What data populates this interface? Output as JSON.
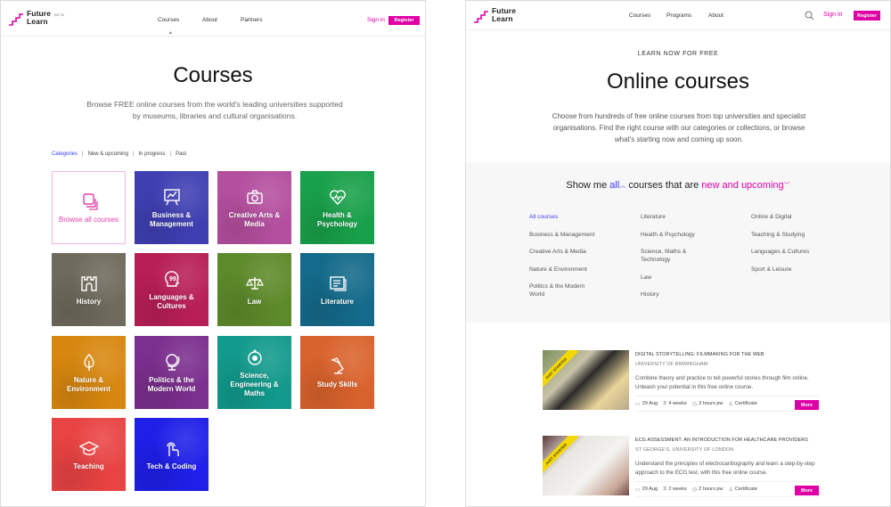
{
  "left": {
    "header": {
      "logo_line1": "Future",
      "logo_line2": "Learn",
      "beta": "BETA",
      "nav": [
        "Courses",
        "About",
        "Partners"
      ],
      "sign_in": "Sign in",
      "register": "Register"
    },
    "title": "Courses",
    "subtitle": "Browse FREE online courses from the world's leading universities supported by museums, libraries and cultural organisations.",
    "tabs": [
      "Categories",
      "New & upcoming",
      "In progress",
      "Past"
    ],
    "active_tab": "Categories",
    "tiles": [
      {
        "label": "Browse all courses",
        "icon": "stack-icon",
        "color": "#ffffff"
      },
      {
        "label": "Business & Management",
        "icon": "presentation-chart-icon",
        "color": "#3f3fb2"
      },
      {
        "label": "Creative Arts & Media",
        "icon": "camera-icon",
        "color": "#b44f9e"
      },
      {
        "label": "Health & Psychology",
        "icon": "heart-pulse-icon",
        "color": "#19a04a"
      },
      {
        "label": "History",
        "icon": "castle-icon",
        "color": "#6e6a5c"
      },
      {
        "label": "Languages & Cultures",
        "icon": "speech-head-icon",
        "color": "#b81f55"
      },
      {
        "label": "Law",
        "icon": "scales-icon",
        "color": "#5d8a2a"
      },
      {
        "label": "Literature",
        "icon": "book-icon",
        "color": "#146a8a"
      },
      {
        "label": "Nature & Environment",
        "icon": "leaf-icon",
        "color": "#d7870f"
      },
      {
        "label": "Politics & the Modern World",
        "icon": "globe-icon",
        "color": "#7b2f8e"
      },
      {
        "label": "Science, Engineering & Maths",
        "icon": "atom-icon",
        "color": "#129a8c"
      },
      {
        "label": "Study Skills",
        "icon": "desk-lamp-icon",
        "color": "#d9632d"
      },
      {
        "label": "Teaching",
        "icon": "graduation-cap-icon",
        "color": "#e94343"
      },
      {
        "label": "Tech & Coding",
        "icon": "touch-hand-icon",
        "color": "#1f1fe8"
      }
    ]
  },
  "right": {
    "header": {
      "logo_line1": "Future",
      "logo_line2": "Learn",
      "nav": [
        "Courses",
        "Programs",
        "About"
      ],
      "sign_in": "Sign in",
      "register": "Register"
    },
    "kicker": "LEARN NOW FOR FREE",
    "title": "Online courses",
    "subtitle": "Choose from hundreds of free online courses from top universities and specialist organisations. Find the right course with our categories or collections, or browse what's starting now and coming up soon.",
    "filter": {
      "prefix": "Show me",
      "scope": "all",
      "middle": "courses that are",
      "status": "new and upcoming",
      "columns": [
        [
          "All courses",
          "Business & Management",
          "Creative Arts & Media",
          "Nature & Environment",
          "Politics & the Modern World"
        ],
        [
          "Literature",
          "Health & Psychology",
          "Science, Maths & Technology",
          "Law",
          "History"
        ],
        [
          "Online & Digital",
          "Teaching & Studying",
          "Languages & Cultures",
          "Sport & Leisure"
        ]
      ],
      "active": "All courses"
    },
    "courses": [
      {
        "badge": "JUST STARTED",
        "title": "DIGITAL STORYTELLING: FILMMAKING FOR THE WEB",
        "university": "UNIVERSITY OF BIRMINGHAM",
        "description": "Combine theory and practice to tell powerful stories through film online. Unleash your potential in this free online course.",
        "start": "29 Aug",
        "duration": "4 weeks",
        "effort": "3 hours pw",
        "certificate": "Certificate",
        "more": "More"
      },
      {
        "badge": "JUST STARTED",
        "title": "ECG ASSESSMENT: AN INTRODUCTION FOR HEALTHCARE PROVIDERS",
        "university": "ST GEORGE'S, UNIVERSITY OF LONDON",
        "description": "Understand the principles of electrocardiography and learn a step-by-step approach to the ECG test, with this free online course.",
        "start": "29 Aug",
        "duration": "2 weeks",
        "effort": "2 hours pw",
        "certificate": "Certificate",
        "more": "More"
      }
    ]
  },
  "colors": {
    "brand_pink": "#de00a5",
    "link_blue": "#3a3aff"
  }
}
